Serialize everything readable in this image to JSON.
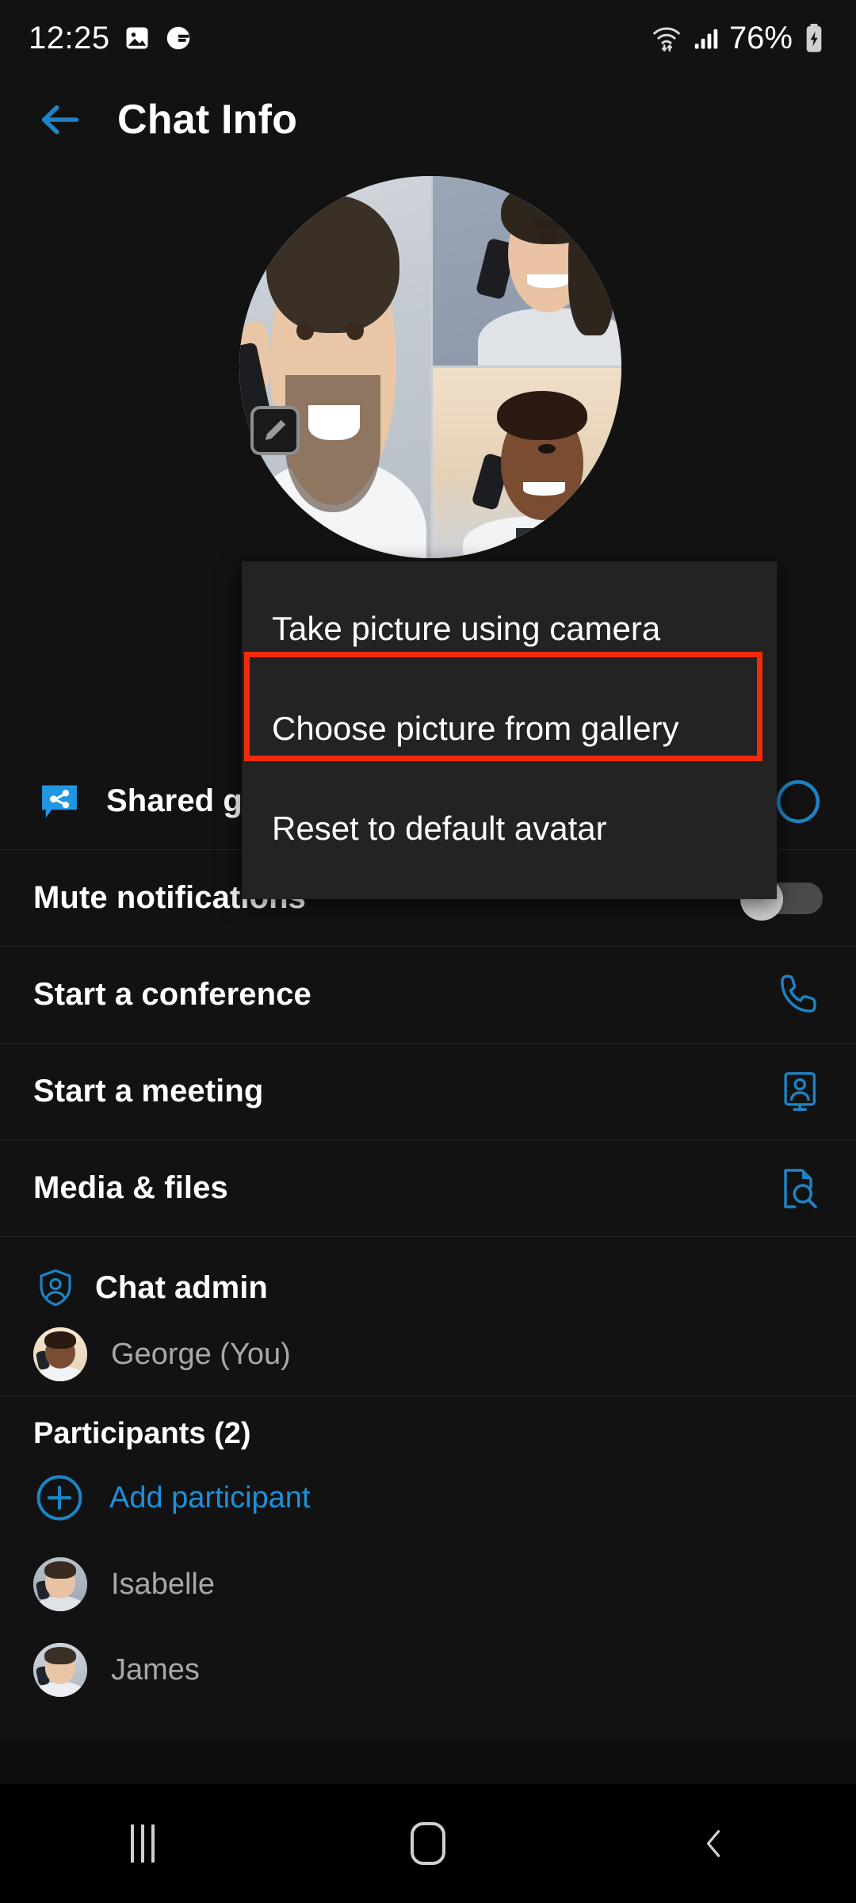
{
  "status_bar": {
    "time": "12:25",
    "left_icons": [
      "image-icon",
      "app-badge-icon"
    ],
    "right_icons": [
      "wifi-icon",
      "signal-icon",
      "battery-charging-icon"
    ],
    "battery_percent": "76%"
  },
  "header": {
    "back_icon": "arrow-left-icon",
    "title": "Chat Info",
    "accent_color": "#1e90d8"
  },
  "avatar": {
    "name": "group-avatar",
    "edit_badge_icon": "edit-pencil-icon"
  },
  "popup_menu": {
    "items": [
      {
        "label": "Take picture using camera",
        "name": "take-picture-using-camera"
      },
      {
        "label": "Choose picture from gallery",
        "name": "choose-picture-from-gallery",
        "highlighted": true
      },
      {
        "label": "Reset to default avatar",
        "name": "reset-to-default-avatar"
      }
    ],
    "highlight_color": "#f22b0c",
    "background": "#232323"
  },
  "rows": [
    {
      "label": "Shared groups",
      "lead_icon": "shared-chat-icon",
      "trail_icon": "circle-icon",
      "name": "shared-groups"
    },
    {
      "label": "Mute notifications",
      "trail_icon": "toggle-off",
      "name": "mute-notifications"
    },
    {
      "label": "Start a conference",
      "trail_icon": "phone-icon",
      "name": "start-a-conference"
    },
    {
      "label": "Start a meeting",
      "trail_icon": "meeting-screen-icon",
      "name": "start-a-meeting"
    },
    {
      "label": "Media & files",
      "trail_icon": "file-search-icon",
      "name": "media-and-files"
    }
  ],
  "admin_section": {
    "icon": "shield-person-icon",
    "title": "Chat admin",
    "admin_name": "George (You)"
  },
  "participants_section": {
    "title": "Participants (2)",
    "add_icon": "plus-circle-icon",
    "add_label": "Add participant",
    "people": [
      {
        "name": "Isabelle"
      },
      {
        "name": "James"
      }
    ]
  },
  "nav_bar": {
    "recents_icon": "recents-icon",
    "home_icon": "home-icon",
    "back_icon": "back-chevron-icon"
  }
}
